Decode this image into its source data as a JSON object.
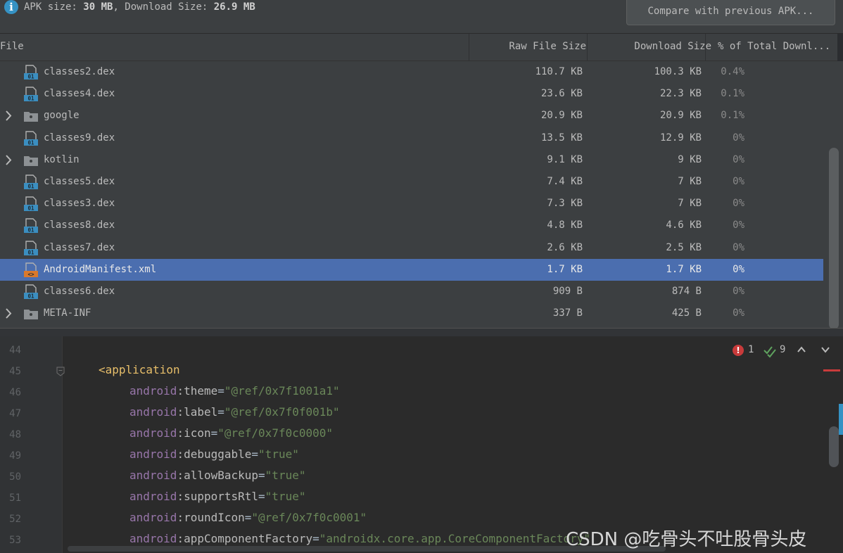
{
  "topbar": {
    "apk_size_label": "APK size: ",
    "apk_size_value": "30 MB",
    "download_size_label": ", Download Size: ",
    "download_size_value": "26.9 MB",
    "compare_button": "Compare with previous APK..."
  },
  "table": {
    "columns": [
      "File",
      "Raw File Size",
      "Download Size",
      "% of Total Downl..."
    ],
    "rows": [
      {
        "name": "classes2.dex",
        "type": "dex",
        "expandable": false,
        "raw": "110.7 KB",
        "download": "100.3 KB",
        "percent": "0.4%"
      },
      {
        "name": "classes4.dex",
        "type": "dex",
        "expandable": false,
        "raw": "23.6 KB",
        "download": "22.3 KB",
        "percent": "0.1%"
      },
      {
        "name": "google",
        "type": "folder",
        "expandable": true,
        "raw": "20.9 KB",
        "download": "20.9 KB",
        "percent": "0.1%"
      },
      {
        "name": "classes9.dex",
        "type": "dex",
        "expandable": false,
        "raw": "13.5 KB",
        "download": "12.9 KB",
        "percent": "0%"
      },
      {
        "name": "kotlin",
        "type": "folder",
        "expandable": true,
        "raw": "9.1 KB",
        "download": "9 KB",
        "percent": "0%"
      },
      {
        "name": "classes5.dex",
        "type": "dex",
        "expandable": false,
        "raw": "7.4 KB",
        "download": "7 KB",
        "percent": "0%"
      },
      {
        "name": "classes3.dex",
        "type": "dex",
        "expandable": false,
        "raw": "7.3 KB",
        "download": "7 KB",
        "percent": "0%"
      },
      {
        "name": "classes8.dex",
        "type": "dex",
        "expandable": false,
        "raw": "4.8 KB",
        "download": "4.6 KB",
        "percent": "0%"
      },
      {
        "name": "classes7.dex",
        "type": "dex",
        "expandable": false,
        "raw": "2.6 KB",
        "download": "2.5 KB",
        "percent": "0%"
      },
      {
        "name": "AndroidManifest.xml",
        "type": "xml",
        "expandable": false,
        "selected": true,
        "raw": "1.7 KB",
        "download": "1.7 KB",
        "percent": "0%"
      },
      {
        "name": "classes6.dex",
        "type": "dex",
        "expandable": false,
        "raw": "909 B",
        "download": "874 B",
        "percent": "0%"
      },
      {
        "name": "META-INF",
        "type": "folder",
        "expandable": true,
        "raw": "337 B",
        "download": "425 B",
        "percent": "0%"
      }
    ]
  },
  "editor": {
    "line_numbers": [
      "44",
      "45",
      "46",
      "47",
      "48",
      "49",
      "50",
      "51",
      "52",
      "53"
    ],
    "lines": [
      [],
      [
        {
          "c": "t-tag",
          "t": "<application"
        }
      ],
      [
        {
          "c": "t-ns",
          "t": "android"
        },
        {
          "c": "t-attr",
          "t": ":theme"
        },
        {
          "c": "t-eq",
          "t": "="
        },
        {
          "c": "t-val",
          "t": "\"@ref/0x7f1001a1\""
        }
      ],
      [
        {
          "c": "t-ns",
          "t": "android"
        },
        {
          "c": "t-attr",
          "t": ":label"
        },
        {
          "c": "t-eq",
          "t": "="
        },
        {
          "c": "t-val",
          "t": "\"@ref/0x7f0f001b\""
        }
      ],
      [
        {
          "c": "t-ns",
          "t": "android"
        },
        {
          "c": "t-attr",
          "t": ":icon"
        },
        {
          "c": "t-eq",
          "t": "="
        },
        {
          "c": "t-val",
          "t": "\"@ref/0x7f0c0000\""
        }
      ],
      [
        {
          "c": "t-ns",
          "t": "android"
        },
        {
          "c": "t-attr",
          "t": ":debuggable"
        },
        {
          "c": "t-eq",
          "t": "="
        },
        {
          "c": "t-val",
          "t": "\"true\""
        }
      ],
      [
        {
          "c": "t-ns",
          "t": "android"
        },
        {
          "c": "t-attr",
          "t": ":allowBackup"
        },
        {
          "c": "t-eq",
          "t": "="
        },
        {
          "c": "t-val",
          "t": "\"true\""
        }
      ],
      [
        {
          "c": "t-ns",
          "t": "android"
        },
        {
          "c": "t-attr",
          "t": ":supportsRtl"
        },
        {
          "c": "t-eq",
          "t": "="
        },
        {
          "c": "t-val",
          "t": "\"true\""
        }
      ],
      [
        {
          "c": "t-ns",
          "t": "android"
        },
        {
          "c": "t-attr",
          "t": ":roundIcon"
        },
        {
          "c": "t-eq",
          "t": "="
        },
        {
          "c": "t-val",
          "t": "\"@ref/0x7f0c0001\""
        }
      ],
      [
        {
          "c": "t-ns",
          "t": "android"
        },
        {
          "c": "t-attr",
          "t": ":appComponentFactory"
        },
        {
          "c": "t-eq",
          "t": "="
        },
        {
          "c": "t-val",
          "t": "\"androidx.core.app.CoreComponentFactory\""
        }
      ]
    ],
    "error_count": "1",
    "warning_count": "9"
  },
  "watermark": "CSDN @吃骨头不吐股骨头皮",
  "colors": {
    "selection": "#4b6eaf",
    "tag": "#e8bf6a",
    "namespace": "#9876aa",
    "string": "#6a8759",
    "error": "#c93b3b"
  }
}
